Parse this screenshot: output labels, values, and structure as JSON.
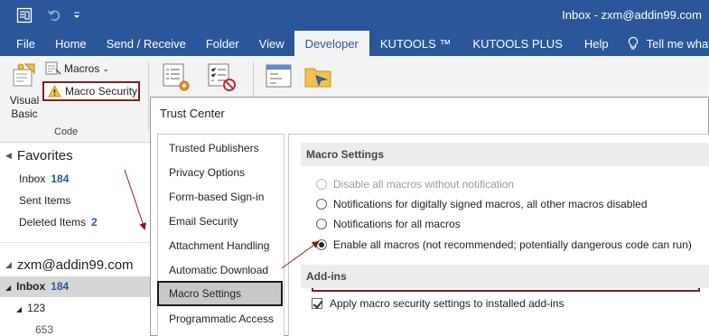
{
  "titlebar": {
    "title": "Inbox - zxm@addin99.com",
    "qat": [
      "outlook-app-icon",
      "undo-icon",
      "customize-qat-icon"
    ]
  },
  "tabs": [
    {
      "label": "File",
      "active": false
    },
    {
      "label": "Home",
      "active": false
    },
    {
      "label": "Send / Receive",
      "active": false
    },
    {
      "label": "Folder",
      "active": false
    },
    {
      "label": "View",
      "active": false
    },
    {
      "label": "Developer",
      "active": true
    },
    {
      "label": "KUTOOLS ™",
      "active": false
    },
    {
      "label": "KUTOOLS PLUS",
      "active": false
    },
    {
      "label": "Help",
      "active": false
    },
    {
      "label": "Tell me what yo",
      "active": false
    }
  ],
  "ribbon": {
    "visual_basic_line1": "Visual",
    "visual_basic_line2": "Basic",
    "macros_label": "Macros",
    "macro_security_label": "Macro Security",
    "group_label": "Code"
  },
  "nav": {
    "favorites_label": "Favorites",
    "favorites": [
      {
        "label": "Inbox",
        "count": "184"
      },
      {
        "label": "Sent Items",
        "count": ""
      },
      {
        "label": "Deleted Items",
        "count": "2"
      }
    ],
    "account_label": "zxm@addin99.com",
    "inbox_label": "Inbox",
    "inbox_count": "184",
    "sub_folder": "123",
    "sub_count": "653"
  },
  "dialog": {
    "title": "Trust Center",
    "categories": [
      "Trusted Publishers",
      "Privacy Options",
      "Form-based Sign-in",
      "Email Security",
      "Attachment Handling",
      "Automatic Download",
      "Macro Settings",
      "Programmatic Access"
    ],
    "selected_category": "Macro Settings",
    "macro_settings_header": "Macro Settings",
    "options": [
      {
        "label": "Disable all macros without notification",
        "checked": false,
        "enabled": false
      },
      {
        "label": "Notifications for digitally signed macros, all other macros disabled",
        "checked": false,
        "enabled": true
      },
      {
        "label": "Notifications for all macros",
        "checked": false,
        "enabled": true
      },
      {
        "label": "Enable all macros (not recommended; potentially dangerous code can run)",
        "checked": true,
        "enabled": true
      }
    ],
    "addins_header": "Add-ins",
    "addins_checkbox_label": "Apply macro security settings to installed add-ins",
    "addins_checked": true
  },
  "colors": {
    "brand": "#2b579a",
    "highlight_border": "#8b1a1a",
    "selected_item_bg": "#c8c8c8"
  }
}
